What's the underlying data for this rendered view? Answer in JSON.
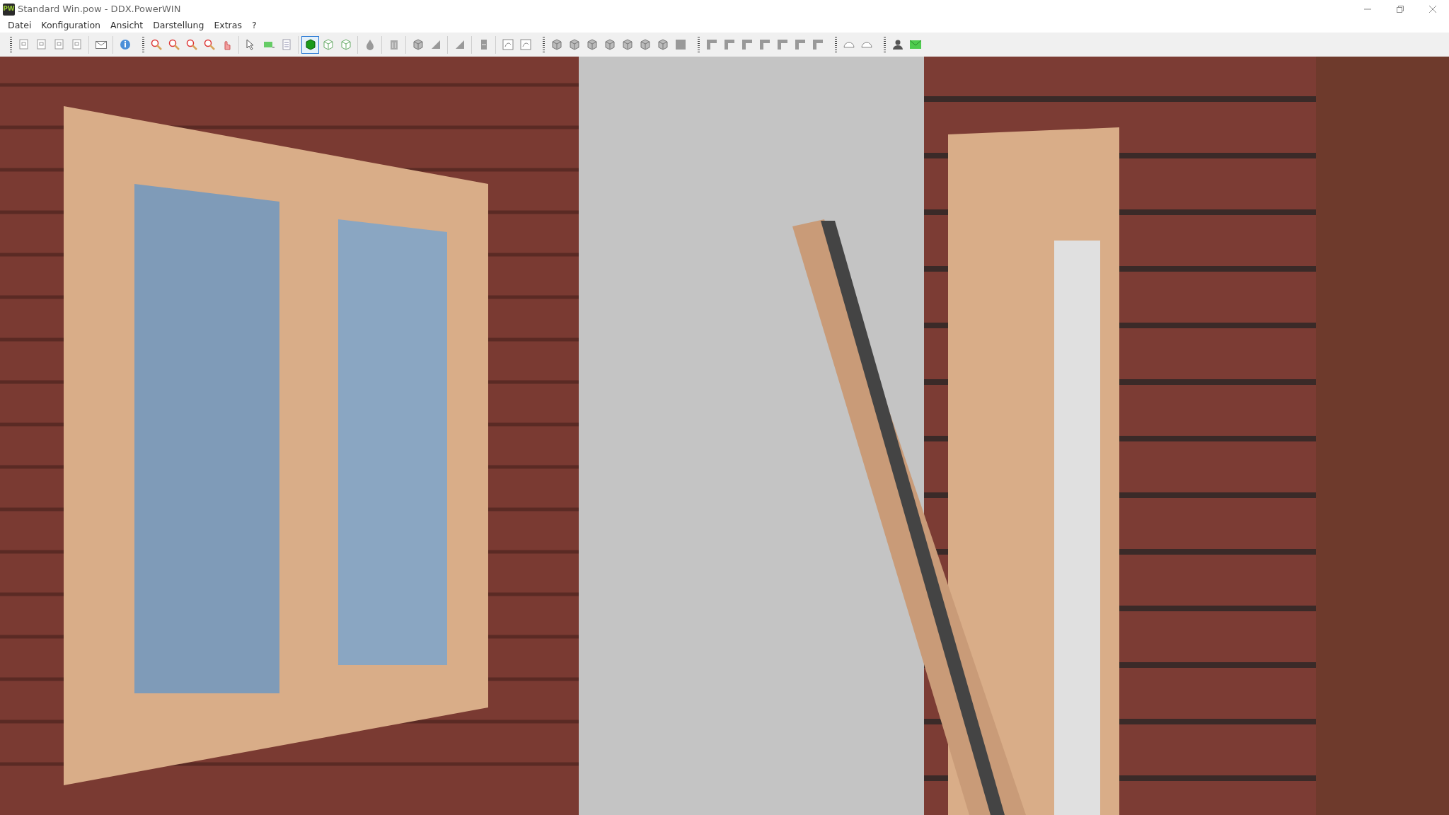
{
  "window": {
    "title": "Standard Win.pow - DDX.PowerWIN",
    "app_badge": "PW"
  },
  "menu": [
    {
      "label": "Datei"
    },
    {
      "label": "Konfiguration"
    },
    {
      "label": "Ansicht"
    },
    {
      "label": "Darstellung"
    },
    {
      "label": "Extras"
    },
    {
      "label": "?"
    }
  ],
  "toolbar": [
    {
      "kind": "grip",
      "buttons": [
        {
          "selected": false
        },
        {
          "selected": false
        },
        {
          "selected": false
        },
        {
          "selected": false
        }
      ]
    },
    {
      "kind": "separator",
      "buttons": [
        {
          "selected": false
        }
      ]
    },
    {
      "kind": "separator",
      "buttons": [
        {
          "selected": false
        }
      ]
    },
    {
      "kind": "grip",
      "buttons": [
        {
          "selected": false
        },
        {
          "selected": false
        },
        {
          "selected": false
        },
        {
          "selected": false
        },
        {
          "selected": false
        }
      ]
    },
    {
      "kind": "separator",
      "buttons": [
        {
          "selected": false
        },
        {
          "selected": false
        },
        {
          "selected": false
        }
      ]
    },
    {
      "kind": "separator",
      "buttons": [
        {
          "selected": true
        },
        {
          "selected": false
        },
        {
          "selected": false
        }
      ]
    },
    {
      "kind": "separator",
      "buttons": [
        {
          "selected": false
        }
      ]
    },
    {
      "kind": "separator",
      "buttons": [
        {
          "selected": false
        }
      ]
    },
    {
      "kind": "separator",
      "buttons": [
        {
          "selected": false
        },
        {
          "selected": false
        }
      ]
    },
    {
      "kind": "separator",
      "buttons": [
        {
          "selected": false
        }
      ]
    },
    {
      "kind": "separator",
      "buttons": [
        {
          "selected": false
        }
      ]
    },
    {
      "kind": "separator",
      "buttons": [
        {
          "selected": false
        },
        {
          "selected": false
        }
      ]
    },
    {
      "kind": "grip",
      "buttons": [
        {
          "selected": false
        },
        {
          "selected": false
        },
        {
          "selected": false
        },
        {
          "selected": false
        },
        {
          "selected": false
        },
        {
          "selected": false
        },
        {
          "selected": false
        },
        {
          "selected": false
        }
      ]
    },
    {
      "kind": "grip",
      "buttons": [
        {
          "selected": false
        },
        {
          "selected": false
        },
        {
          "selected": false
        },
        {
          "selected": false
        },
        {
          "selected": false
        },
        {
          "selected": false
        },
        {
          "selected": false
        }
      ]
    },
    {
      "kind": "grip",
      "buttons": [
        {
          "selected": false
        },
        {
          "selected": false
        }
      ]
    },
    {
      "kind": "grip",
      "buttons": [
        {
          "selected": false
        },
        {
          "selected": false
        }
      ]
    }
  ]
}
